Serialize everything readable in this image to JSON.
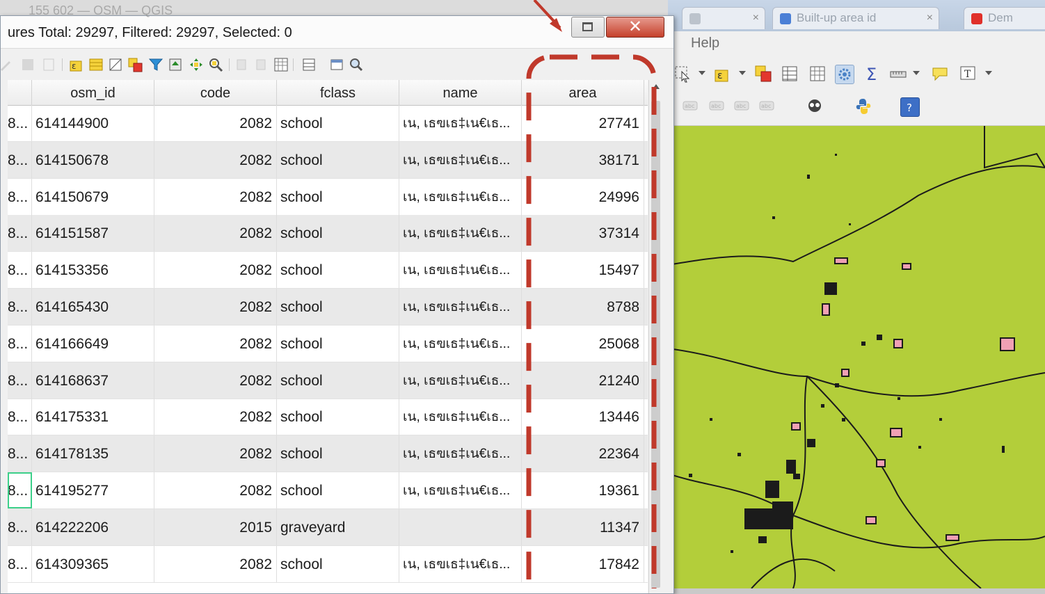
{
  "dialog": {
    "title": "ures Total: 29297, Filtered: 29297, Selected: 0",
    "title_ghost": "155 602 — OSM — QGIS",
    "close_glyph": "✕"
  },
  "background": {
    "menu_help": "Help",
    "tabs": [
      {
        "label": "",
        "favicon_color": "#bcc3cc"
      },
      {
        "label": "Built-up area id",
        "favicon_color": "#4a7fd6"
      },
      {
        "label": "Dem",
        "favicon_color": "#e0302a"
      }
    ],
    "map_fill_color": "#b3ce3a",
    "polygon_fill_color": "#f0a0b4"
  },
  "table": {
    "columns": [
      "",
      "osm_id",
      "code",
      "fclass",
      "name",
      "area"
    ],
    "rows": [
      {
        "id": "8...",
        "osm_id": "614144900",
        "code": "2082",
        "fclass": "school",
        "name": "เน, เธฃเธ‡เน€เธ...",
        "area": "27741"
      },
      {
        "id": "8...",
        "osm_id": "614150678",
        "code": "2082",
        "fclass": "school",
        "name": "เน, เธฃเธ‡เน€เธ...",
        "area": "38171"
      },
      {
        "id": "8...",
        "osm_id": "614150679",
        "code": "2082",
        "fclass": "school",
        "name": "เน, เธฃเธ‡เน€เธ...",
        "area": "24996"
      },
      {
        "id": "8...",
        "osm_id": "614151587",
        "code": "2082",
        "fclass": "school",
        "name": "เน, เธฃเธ‡เน€เธ...",
        "area": "37314"
      },
      {
        "id": "8...",
        "osm_id": "614153356",
        "code": "2082",
        "fclass": "school",
        "name": "เน, เธฃเธ‡เน€เธ...",
        "area": "15497"
      },
      {
        "id": "8...",
        "osm_id": "614165430",
        "code": "2082",
        "fclass": "school",
        "name": "เน, เธฃเธ‡เน€เธ...",
        "area": "8788"
      },
      {
        "id": "8...",
        "osm_id": "614166649",
        "code": "2082",
        "fclass": "school",
        "name": "เน, เธฃเธ‡เน€เธ...",
        "area": "25068"
      },
      {
        "id": "8...",
        "osm_id": "614168637",
        "code": "2082",
        "fclass": "school",
        "name": "เน, เธฃเธ‡เน€เธ...",
        "area": "21240"
      },
      {
        "id": "8...",
        "osm_id": "614175331",
        "code": "2082",
        "fclass": "school",
        "name": "เน, เธฃเธ‡เน€เธ...",
        "area": "13446"
      },
      {
        "id": "8...",
        "osm_id": "614178135",
        "code": "2082",
        "fclass": "school",
        "name": "เน, เธฃเธ‡เน€เธ...",
        "area": "22364"
      },
      {
        "id": "8...",
        "osm_id": "614195277",
        "code": "2082",
        "fclass": "school",
        "name": "เน, เธฃเธ‡เน€เธ...",
        "area": "19361"
      },
      {
        "id": "8...",
        "osm_id": "614222206",
        "code": "2015",
        "fclass": "graveyard",
        "name": "",
        "area": "11347"
      },
      {
        "id": "8...",
        "osm_id": "614309365",
        "code": "2082",
        "fclass": "school",
        "name": "เน, เธฃเธ‡เน€เธ...",
        "area": "17842"
      }
    ]
  },
  "annotation": {
    "color": "#c0392b"
  }
}
